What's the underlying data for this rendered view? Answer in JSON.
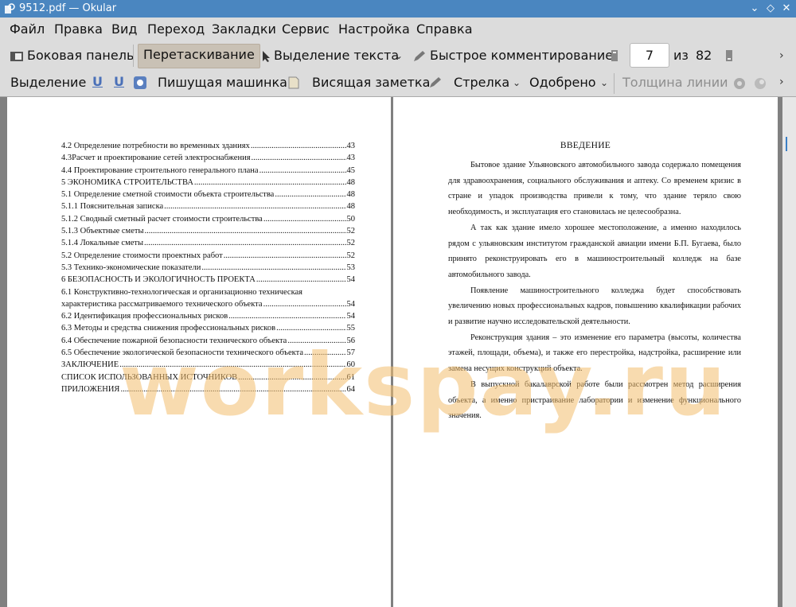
{
  "window": {
    "title": "9512.pdf  — Okular"
  },
  "menubar": {
    "items": [
      "Файл",
      "Правка",
      "Вид",
      "Переход",
      "Закладки",
      "Сервис",
      "Настройка",
      "Справка"
    ]
  },
  "toolbar1": {
    "sidebar": "Боковая панель",
    "drag": "Перетаскивание",
    "text_select": "Выделение текста",
    "quick_comment": "Быстрое комментирование",
    "page_current": "7",
    "page_of": "из",
    "page_total": "82"
  },
  "toolbar2": {
    "selection": "Выделение",
    "typewriter": "Пишущая машинка",
    "note": "Висящая заметка",
    "arrow": "Стрелка",
    "approved": "Одобрено",
    "line_width": "Толщина линии"
  },
  "toc": [
    {
      "text": "4.2 Определение потребности во временных зданиях",
      "page": "43"
    },
    {
      "text": "4.3Расчет и проектирование сетей электроснабжения",
      "page": "43"
    },
    {
      "text": "4.4 Проектирование строительного генерального плана",
      "page": "45"
    },
    {
      "text": "5 ЭКОНОМИКА СТРОИТЕЛЬСТВА",
      "page": "48"
    },
    {
      "text": "5.1 Определение сметной стоимости объекта строительства",
      "page": "48"
    },
    {
      "text": "5.1.1 Пояснительная записка",
      "page": "48"
    },
    {
      "text": "5.1.2 Сводный сметный расчет стоимости строительства",
      "page": "50"
    },
    {
      "text": "5.1.3 Объектные сметы",
      "page": "52"
    },
    {
      "text": "5.1.4 Локальные сметы",
      "page": "52"
    },
    {
      "text": "5.2 Определение стоимости проектных работ",
      "page": "52"
    },
    {
      "text": "5.3 Технико-экономические показатели",
      "page": "53"
    },
    {
      "text": "6 БЕЗОПАСНОСТЬ И ЭКОЛОГИЧНОСТЬ ПРОЕКТА",
      "page": "54"
    }
  ],
  "toc_multiline": {
    "line1": "6.1 Конструктивно-технологическая и организационно техническая",
    "line2": "характеристика рассматриваемого технического объекта",
    "page": "54"
  },
  "toc_tail": [
    {
      "text": "6.2 Идентификация профессиональных рисков",
      "page": "54"
    },
    {
      "text": "6.3 Методы и средства снижения профессиональных рисков",
      "page": "55"
    },
    {
      "text": "6.4 Обеспечение пожарной безопасности технического объекта",
      "page": "56"
    },
    {
      "text": "6.5 Обеспечение экологической безопасности технического объекта",
      "page": "57"
    },
    {
      "text": "ЗАКЛЮЧЕНИЕ",
      "page": "60"
    },
    {
      "text": "СПИСОК ИСПОЛЬЗОВАННЫХ ИСТОЧНИКОВ",
      "page": "61"
    },
    {
      "text": "ПРИЛОЖЕНИЯ",
      "page": "64"
    }
  ],
  "intro": {
    "title": "ВВЕДЕНИЕ",
    "paragraphs": [
      "Бытовое здание Ульяновского автомобильного завода содержало помещения для здравоохранения, социального обслуживания и аптеку. Со временем кризис в стране и упадок производства привели к тому, что здание теряло свою необходимость, и эксплуатация его становилась не целесообразна.",
      "А так как здание имело хорошее местоположение, а именно находилось рядом с ульяновским институтом гражданской авиации имени Б.П. Бугаева, было принято реконструировать его в машиностроительный колледж на базе автомобильного завода.",
      "Появление машиностроительного колледжа будет способствовать увеличению новых профессиональных кадров, повышению квалификации рабочих и развитие научно исследовательской деятельности.",
      "Реконструкция здания – это изменение его параметра (высоты, количества этажей, площади, объема), и также его перестройка, надстройка, расширение или замена несущих конструкций объекта.",
      "В выпускной бакалаврской работе были рассмотрен метод расширения объекта, а именно пристраивание лаборатории и изменение функционального значения."
    ]
  },
  "watermark": "workspay.ru"
}
